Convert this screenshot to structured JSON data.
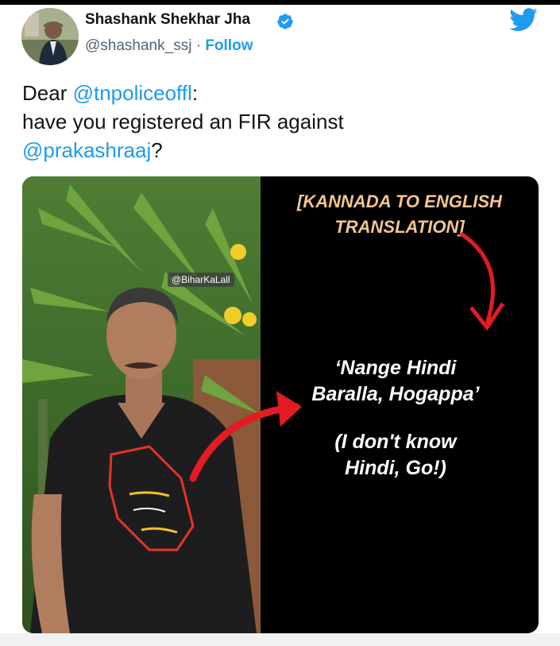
{
  "author": {
    "display_name": "Shashank Shekhar Jha",
    "handle": "@shashank_ssj",
    "separator": "·",
    "follow_label": "Follow"
  },
  "tweet": {
    "line1_prefix": "Dear ",
    "mention1": "@tnpoliceoffl",
    "line1_suffix": ":",
    "line2": "have you registered an FIR against",
    "mention2": "@prakashraaj",
    "line3_suffix": "?"
  },
  "media": {
    "watermark": "@BiharKaLall",
    "heading_line1": "[KANNADA TO ENGLISH",
    "heading_line2": "TRANSLATION]",
    "quote_line1": "‘Nange Hindi",
    "quote_line2": "Baralla, Hogappa’",
    "translation_line1": "(I don't know",
    "translation_line2": "Hindi, Go!)"
  },
  "colors": {
    "link": "#1d9bf0",
    "text": "#0f1419",
    "muted": "#536471",
    "heading": "#f4c58f",
    "arrow": "#e31b23"
  },
  "icons": [
    "verified-badge-icon",
    "twitter-bird-icon"
  ]
}
